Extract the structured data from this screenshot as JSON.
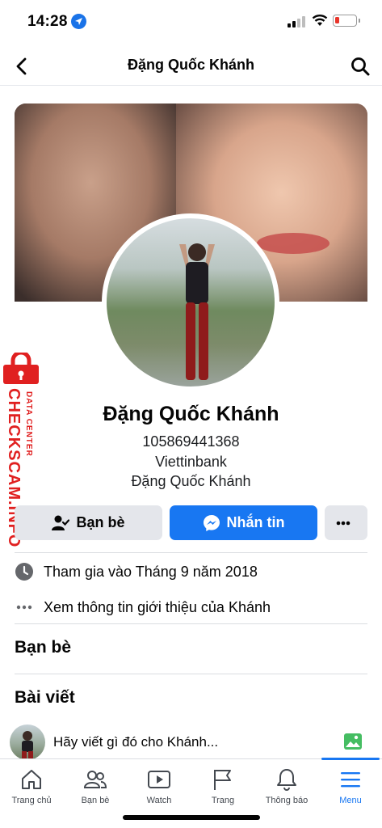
{
  "status_bar": {
    "time": "14:28"
  },
  "nav": {
    "title": "Đặng Quốc Khánh"
  },
  "profile": {
    "name": "Đặng Quốc Khánh",
    "info_lines": [
      "105869441368",
      "Viettinbank",
      "Đặng Quốc Khánh"
    ]
  },
  "watermark": {
    "brand": "CHECKSCAM.INFO",
    "sub": "DATA CENTER"
  },
  "actions": {
    "friends_label": "Bạn bè",
    "message_label": "Nhắn tin"
  },
  "details": {
    "joined": "Tham gia vào Tháng 9 năm 2018",
    "see_more": "Xem thông tin giới thiệu của Khánh"
  },
  "sections": {
    "friends": "Bạn bè",
    "posts": "Bài viết"
  },
  "composer": {
    "placeholder": "Hãy viết gì đó cho Khánh..."
  },
  "tabs": [
    {
      "label": "Trang chủ",
      "icon": "home-icon"
    },
    {
      "label": "Bạn bè",
      "icon": "friends-icon"
    },
    {
      "label": "Watch",
      "icon": "watch-icon"
    },
    {
      "label": "Trang",
      "icon": "flag-icon"
    },
    {
      "label": "Thông báo",
      "icon": "bell-icon"
    },
    {
      "label": "Menu",
      "icon": "menu-icon",
      "active": true
    }
  ],
  "colors": {
    "accent": "#1877f2",
    "button_gray": "#e4e6eb",
    "watermark": "#e02020"
  }
}
